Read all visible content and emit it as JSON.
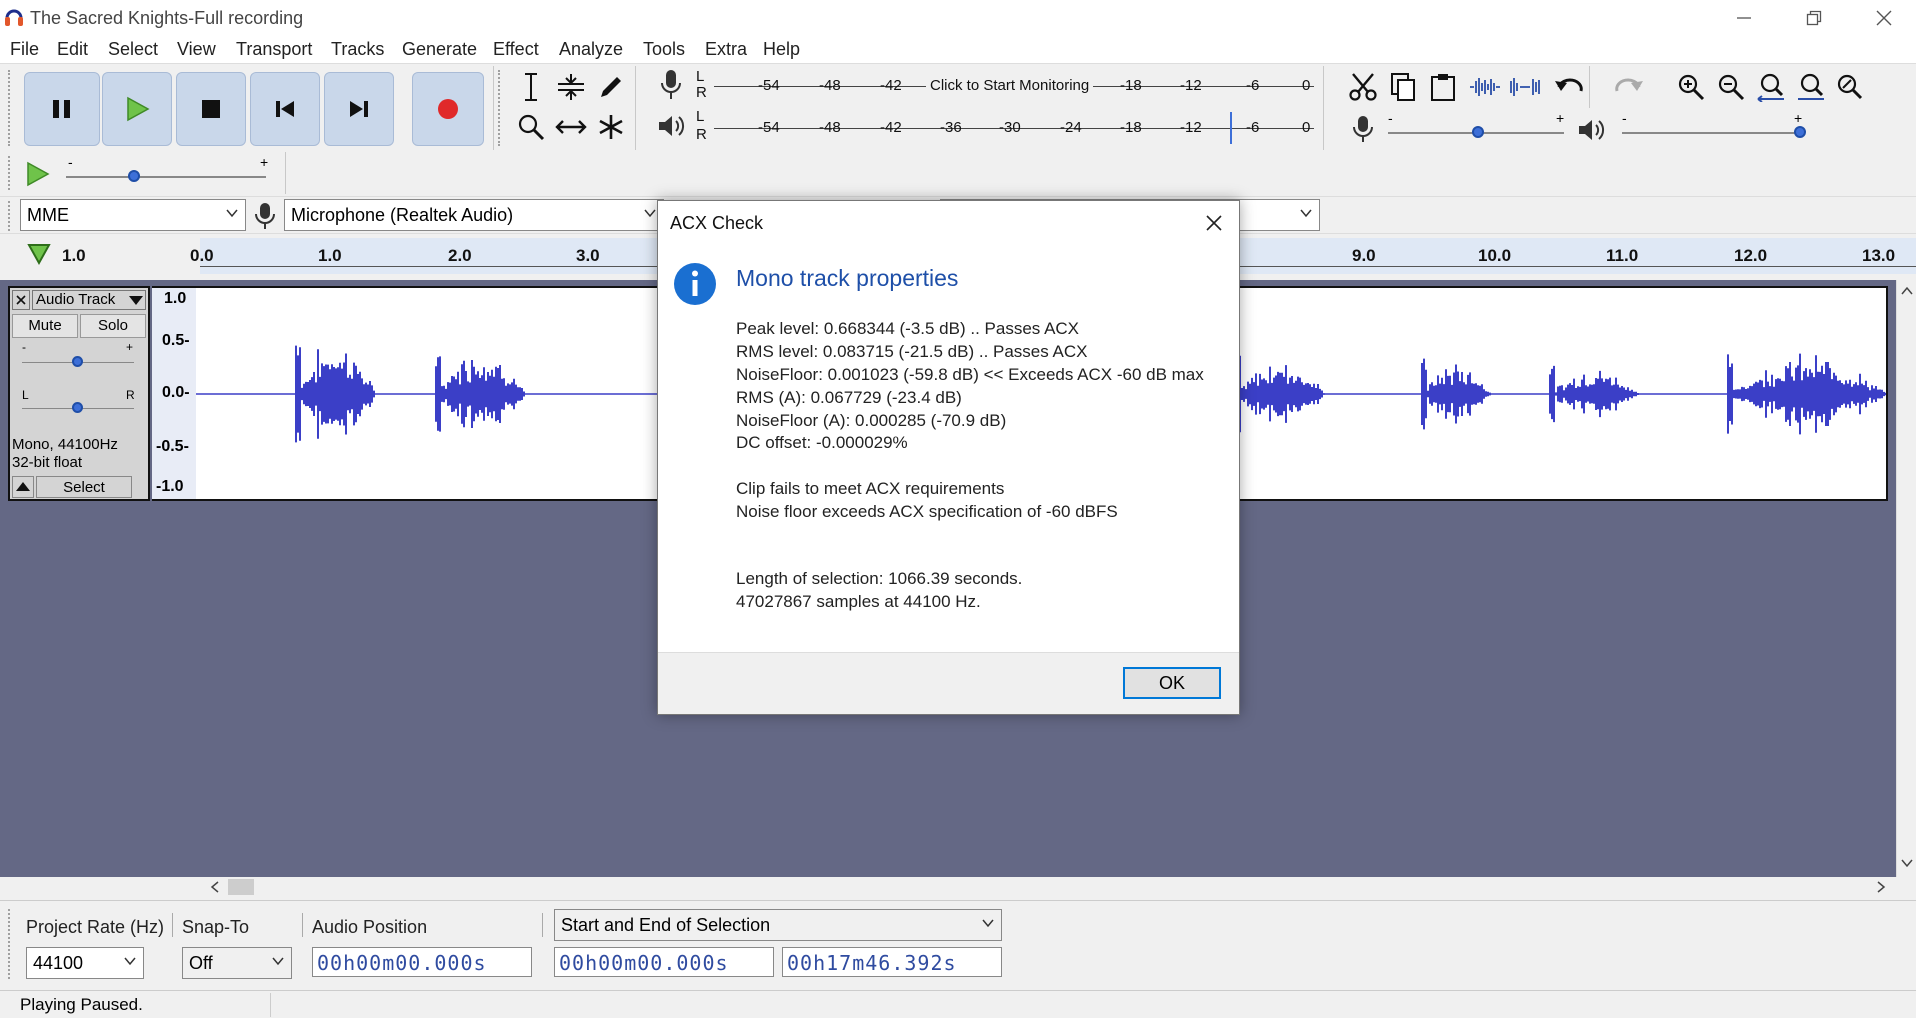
{
  "window": {
    "title": "The Sacred Knights-Full recording"
  },
  "menu": [
    "File",
    "Edit",
    "Select",
    "View",
    "Transport",
    "Tracks",
    "Generate",
    "Effect",
    "Analyze",
    "Tools",
    "Extra",
    "Help"
  ],
  "meters": {
    "rec_ticks": [
      "-54",
      "-48",
      "-42",
      "Click to Start Monitoring",
      "-18",
      "-12",
      "-6",
      "0"
    ],
    "play_ticks": [
      "-54",
      "-48",
      "-42",
      "-36",
      "-30",
      "-24",
      "-18",
      "-12",
      "-6",
      "0"
    ],
    "lr": [
      "L",
      "R"
    ]
  },
  "device": {
    "host": "MME",
    "input": "Microphone (Realtek Audio)"
  },
  "ruler": {
    "left_label": "1.0",
    "labels_left": [
      "0.0",
      "1.0",
      "2.0",
      "3.0"
    ],
    "labels_right": [
      "9.0",
      "10.0",
      "11.0",
      "12.0",
      "13.0"
    ]
  },
  "track": {
    "name": "Audio Track",
    "mute": "Mute",
    "solo": "Solo",
    "gain_minus": "-",
    "gain_plus": "+",
    "pan_l": "L",
    "pan_r": "R",
    "info1": "Mono, 44100Hz",
    "info2": "32-bit float",
    "select": "Select",
    "scale": [
      "1.0",
      "0.5-",
      "0.0-",
      "-0.5-",
      "-1.0"
    ]
  },
  "dialog": {
    "title": "ACX Check",
    "heading": "Mono track properties",
    "lines": [
      "Peak level: 0.668344 (-3.5 dB)  .. Passes ACX",
      "RMS level: 0.083715 (-21.5 dB)  .. Passes ACX",
      "NoiseFloor: 0.001023 (-59.8 dB)  << Exceeds ACX -60 dB max",
      "RMS (A): 0.067729 (-23.4 dB)",
      "NoiseFloor (A): 0.000285 (-70.9 dB)",
      "DC offset: -0.000029%"
    ],
    "fail_lines": [
      "Clip fails to meet ACX requirements",
      "Noise floor exceeds ACX specification of -60 dBFS"
    ],
    "length_lines": [
      "Length of selection: 1066.39 seconds.",
      "47027867 samples at 44100 Hz."
    ],
    "ok": "OK"
  },
  "selection_toolbar": {
    "project_rate_label": "Project Rate (Hz)",
    "project_rate": "44100",
    "snap_label": "Snap-To",
    "snap_value": "Off",
    "audio_pos_label": "Audio Position",
    "audio_pos": "00h00m00.000s",
    "selection_mode": "Start and End of Selection",
    "sel_start": "00h00m00.000s",
    "sel_end": "00h17m46.392s"
  },
  "status": "Playing Paused."
}
